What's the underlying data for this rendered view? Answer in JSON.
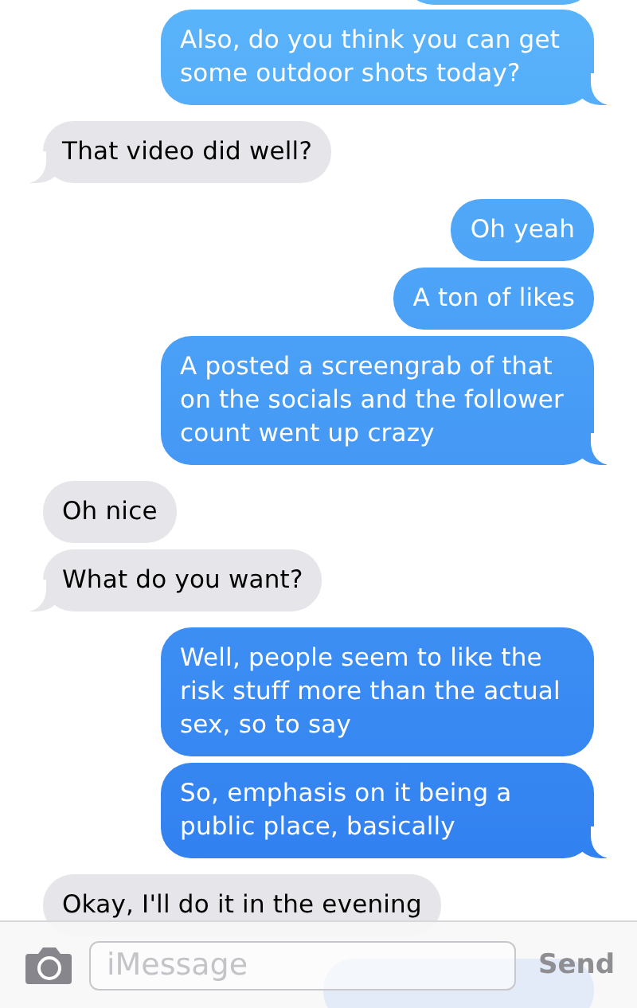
{
  "messages": [
    {
      "kind": "sent",
      "text": "Also, do you think you can get some outdoor shots today?",
      "tail": true
    },
    {
      "kind": "received",
      "text": "That video did well?",
      "tail": true
    },
    {
      "kind": "sent",
      "text": "Oh yeah",
      "tail": false
    },
    {
      "kind": "sent",
      "text": "A ton of likes",
      "tail": false
    },
    {
      "kind": "sent",
      "text": "A posted a screengrab of that on the socials and the follower count went up crazy",
      "tail": true
    },
    {
      "kind": "received",
      "text": "Oh nice",
      "tail": false
    },
    {
      "kind": "received",
      "text": "What do you want?",
      "tail": true
    },
    {
      "kind": "sent",
      "text": "Well, people seem to like the risk stuff more than the actual sex, so to say",
      "tail": false
    },
    {
      "kind": "sent",
      "text": "So, emphasis on it being a public place, basically",
      "tail": true
    },
    {
      "kind": "received",
      "text": "Okay, I'll do it in the evening",
      "tail": false
    }
  ],
  "composer": {
    "placeholder": "iMessage",
    "send": "Send"
  }
}
